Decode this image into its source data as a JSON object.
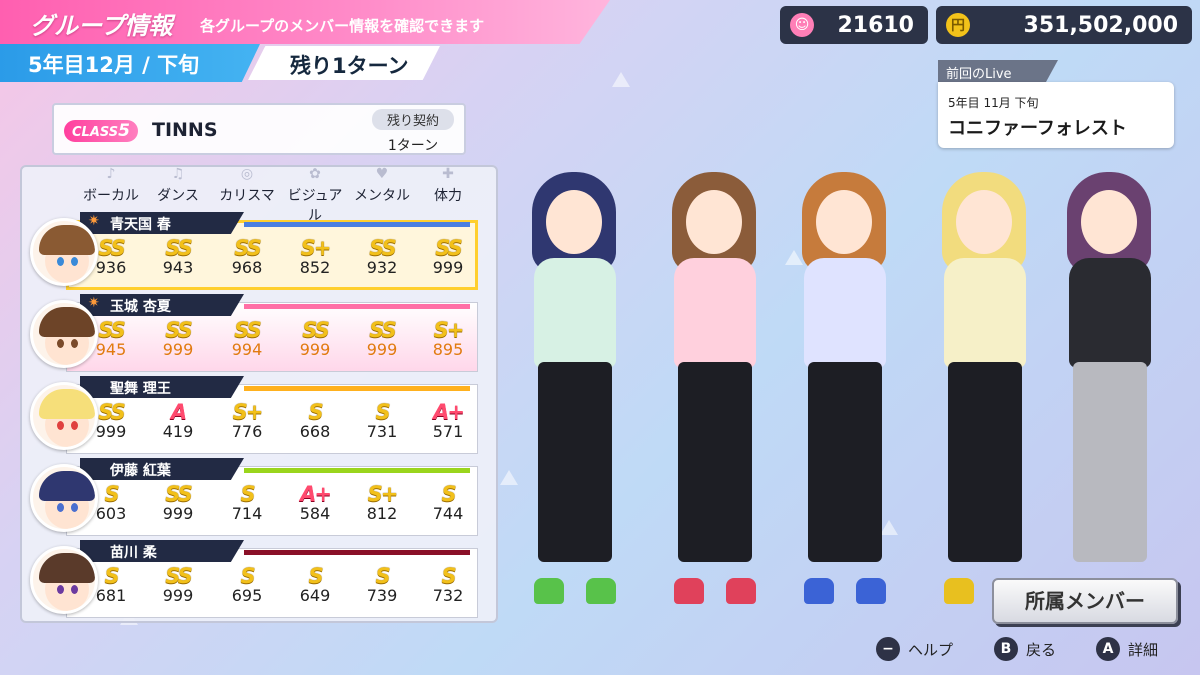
{
  "header": {
    "title": "グループ情報",
    "subtitle": "各グループのメンバー情報を確認できます",
    "date": "5年目12月 / 下旬",
    "turns_left": "残り1ターン"
  },
  "currency": {
    "fans": "21610",
    "money": "351,502,000",
    "fan_icon": "smile-face-icon",
    "money_icon": "yen-coin-icon"
  },
  "previous_live": {
    "label": "前回のLive",
    "date": "5年目 11月 下旬",
    "name": "コニファーフォレスト"
  },
  "group": {
    "class_label": "CLASS",
    "class_number": "5",
    "name": "TINNS",
    "contract_label": "残り契約",
    "contract_value": "1ターン"
  },
  "columns": [
    "ボーカル",
    "ダンス",
    "カリスマ",
    "ビジュアル",
    "メンタル",
    "体力"
  ],
  "members": [
    {
      "name": "青天国 春",
      "ranks": [
        "SS",
        "SS",
        "SS",
        "S+",
        "SS",
        "SS"
      ],
      "values": [
        "936",
        "943",
        "968",
        "852",
        "932",
        "999"
      ],
      "stripe": "#4a7fe0",
      "hair": "#8a5a33",
      "eye": "#3a8ad8"
    },
    {
      "name": "玉城 杏夏",
      "ranks": [
        "SS",
        "SS",
        "SS",
        "SS",
        "SS",
        "S+"
      ],
      "values": [
        "945",
        "999",
        "994",
        "999",
        "999",
        "895"
      ],
      "stripe": "#ff6fa6",
      "hair": "#6d4428",
      "eye": "#7a4a2a"
    },
    {
      "name": "聖舞 理王",
      "ranks": [
        "SS",
        "A",
        "S+",
        "S",
        "S",
        "A+"
      ],
      "values": [
        "999",
        "419",
        "776",
        "668",
        "731",
        "571"
      ],
      "stripe": "#ffb11e",
      "hair": "#f6df7a",
      "eye": "#e0413f"
    },
    {
      "name": "伊藤 紅葉",
      "ranks": [
        "S",
        "SS",
        "S",
        "A+",
        "S+",
        "S"
      ],
      "values": [
        "603",
        "999",
        "714",
        "584",
        "812",
        "744"
      ],
      "stripe": "#9ad51c",
      "hair": "#2f3770",
      "eye": "#4a6fcf"
    },
    {
      "name": "苗川 柔",
      "ranks": [
        "S",
        "SS",
        "S",
        "S",
        "S",
        "S"
      ],
      "values": [
        "681",
        "999",
        "695",
        "649",
        "739",
        "732"
      ],
      "stripe": "#8a1028",
      "hair": "#5a3a2a",
      "eye": "#6b3aa0"
    }
  ],
  "buttons": {
    "members": "所属メンバー",
    "help": "ヘルプ",
    "help_key": "−",
    "back": "戻る",
    "back_key": "B",
    "detail": "詳細",
    "detail_key": "A"
  }
}
